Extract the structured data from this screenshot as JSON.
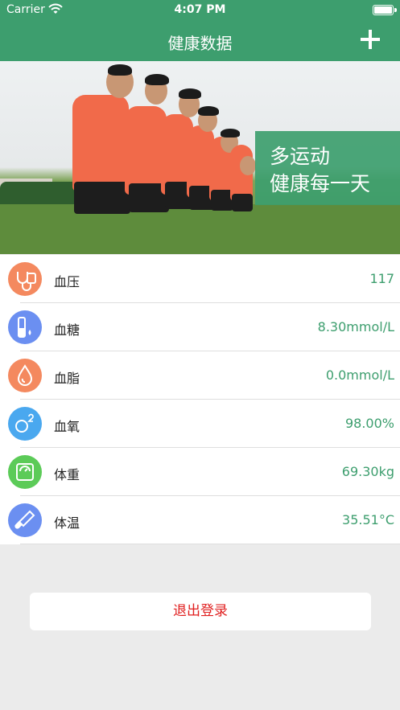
{
  "status_bar": {
    "carrier": "Carrier",
    "time": "4:07 PM"
  },
  "nav": {
    "title": "健康数据",
    "add_icon": "plus-icon"
  },
  "banner": {
    "slogan_line1": "多运动",
    "slogan_line2": "健康每一天"
  },
  "metrics": [
    {
      "label": "血压",
      "value": "117",
      "icon": "blood-pressure-icon",
      "color": "#f4895f"
    },
    {
      "label": "血糖",
      "value": "8.30mmol/L",
      "icon": "blood-sugar-icon",
      "color": "#6b8ff1"
    },
    {
      "label": "血脂",
      "value": "0.0mmol/L",
      "icon": "blood-lipid-icon",
      "color": "#f4895f"
    },
    {
      "label": "血氧",
      "value": "98.00%",
      "icon": "blood-oxygen-icon",
      "color": "#4aa8ef"
    },
    {
      "label": "体重",
      "value": "69.30kg",
      "icon": "weight-scale-icon",
      "color": "#5ccb58"
    },
    {
      "label": "体温",
      "value": "35.51°C",
      "icon": "thermometer-icon",
      "color": "#6b8ff1"
    }
  ],
  "logout": {
    "label": "退出登录"
  },
  "colors": {
    "primary": "#3d9e6e",
    "danger": "#e02020",
    "background": "#ebebeb"
  }
}
